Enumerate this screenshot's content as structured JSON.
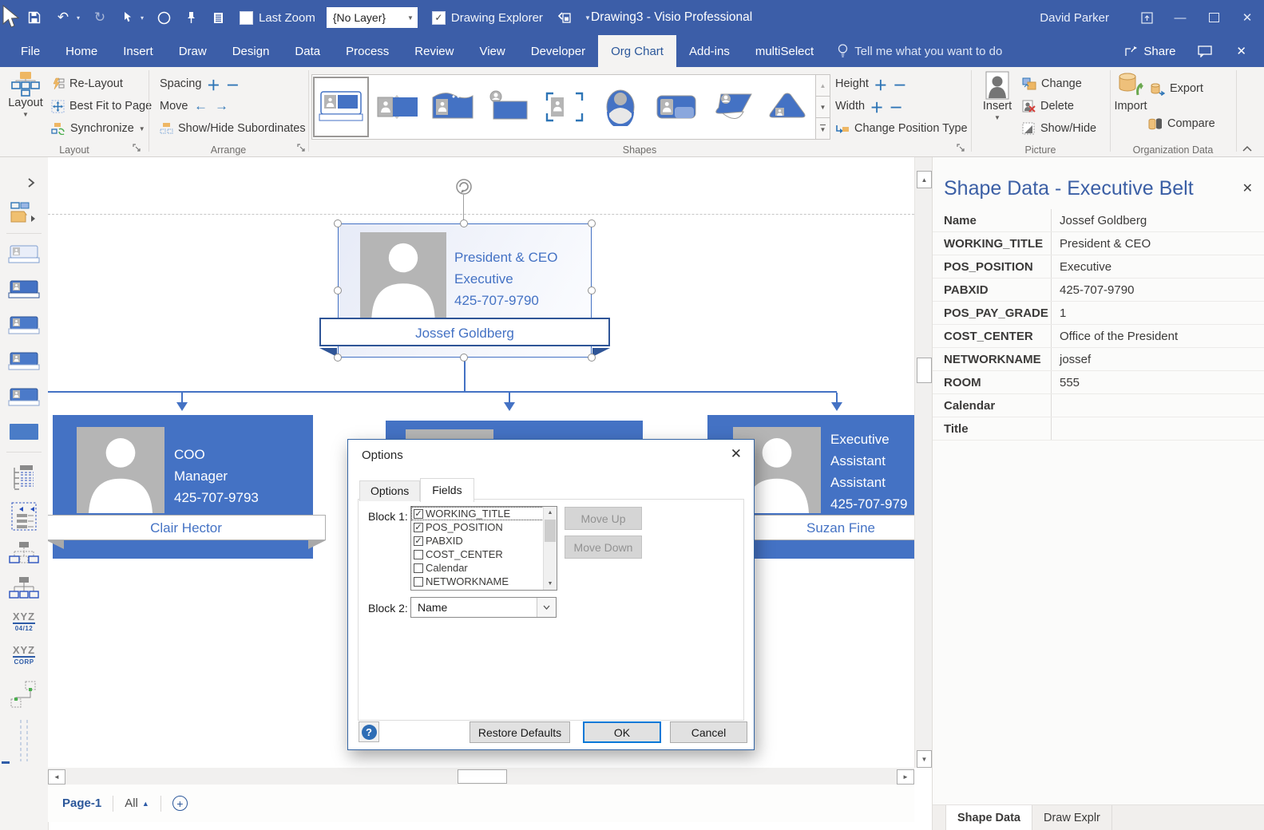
{
  "titlebar": {
    "title": "Drawing3  -  Visio Professional",
    "user": "David Parker",
    "last_zoom": "Last Zoom",
    "layer_dropdown": "{No Layer}",
    "drawing_explorer": "Drawing Explorer"
  },
  "tabs": [
    {
      "label": "File"
    },
    {
      "label": "Home"
    },
    {
      "label": "Insert"
    },
    {
      "label": "Draw"
    },
    {
      "label": "Design"
    },
    {
      "label": "Data"
    },
    {
      "label": "Process"
    },
    {
      "label": "Review"
    },
    {
      "label": "View"
    },
    {
      "label": "Developer"
    },
    {
      "label": "Org Chart",
      "active": true
    },
    {
      "label": "Add-ins"
    },
    {
      "label": "multiSelect"
    }
  ],
  "tellme": "Tell me what you want to do",
  "share": "Share",
  "ribbon": {
    "layout": {
      "big": "Layout",
      "relayout": "Re-Layout",
      "bestfit": "Best Fit to Page",
      "sync": "Synchronize",
      "label": "Layout"
    },
    "arrange": {
      "spacing": "Spacing",
      "move": "Move",
      "subordinates": "Show/Hide Subordinates",
      "label": "Arrange"
    },
    "shapes": {
      "label": "Shapes",
      "height": "Height",
      "width": "Width",
      "change_position_type": "Change Position Type",
      "gallery": [
        "executive-belt",
        "photo-left-band",
        "wave-top",
        "badge-person",
        "bracket-frame",
        "ellipse-person",
        "rounded-card",
        "slant-ribbon",
        "pyramid"
      ]
    },
    "picture": {
      "insert": "Insert",
      "change": "Change",
      "delete": "Delete",
      "showhide": "Show/Hide",
      "label": "Picture"
    },
    "orgdata": {
      "import": "Import",
      "export": "Export",
      "compare": "Compare",
      "label": "Organization Data"
    }
  },
  "canvas": {
    "ceo": {
      "line1": "President & CEO",
      "line2": "Executive",
      "line3": "425-707-9790",
      "name": "Jossef Goldberg"
    },
    "coo": {
      "line1": "COO",
      "line2": "Manager",
      "line3": "425-707-9793",
      "name": "Clair Hector"
    },
    "assistant": {
      "line1": "Executive",
      "line2": "Assistant",
      "line3": "Assistant",
      "line4": "425-707-979",
      "name": "Suzan Fine"
    }
  },
  "dialog": {
    "title": "Options",
    "tab_options": "Options",
    "tab_fields": "Fields",
    "block1": "Block 1:",
    "fields": [
      {
        "label": "WORKING_TITLE",
        "checked": true,
        "focused": true
      },
      {
        "label": "POS_POSITION",
        "checked": true
      },
      {
        "label": "PABXID",
        "checked": true
      },
      {
        "label": "COST_CENTER"
      },
      {
        "label": "Calendar"
      },
      {
        "label": "NETWORKNAME"
      }
    ],
    "move_up": "Move Up",
    "move_down": "Move Down",
    "block2": "Block 2:",
    "block2_value": "Name",
    "restore": "Restore Defaults",
    "ok": "OK",
    "cancel": "Cancel"
  },
  "panel": {
    "title": "Shape Data - Executive Belt",
    "rows": [
      {
        "label": "Name",
        "value": "Jossef Goldberg"
      },
      {
        "label": "WORKING_TITLE",
        "value": "President & CEO"
      },
      {
        "label": "POS_POSITION",
        "value": "Executive"
      },
      {
        "label": "PABXID",
        "value": "425-707-9790"
      },
      {
        "label": "POS_PAY_GRADE",
        "value": "1"
      },
      {
        "label": "COST_CENTER",
        "value": "Office of the President"
      },
      {
        "label": "NETWORKNAME",
        "value": "jossef"
      },
      {
        "label": "ROOM",
        "value": "555"
      },
      {
        "label": "Calendar",
        "value": ""
      },
      {
        "label": "Title",
        "value": ""
      }
    ],
    "bottom_tabs": [
      {
        "label": "Shape Data",
        "active": true
      },
      {
        "label": "Draw Explr"
      }
    ]
  },
  "pagebar": {
    "page": "Page-1",
    "all": "All"
  },
  "sidebar": {
    "xyz1a": "XYZ",
    "xyz1b": "04/12",
    "xyz2a": "XYZ",
    "xyz2b": "CORP"
  },
  "colors": {
    "titlebar": "#3c5ea8",
    "accent": "#2b579a",
    "node_blue": "#4472c4",
    "orange": "#edb258",
    "ok_focus": "#0078d7"
  }
}
